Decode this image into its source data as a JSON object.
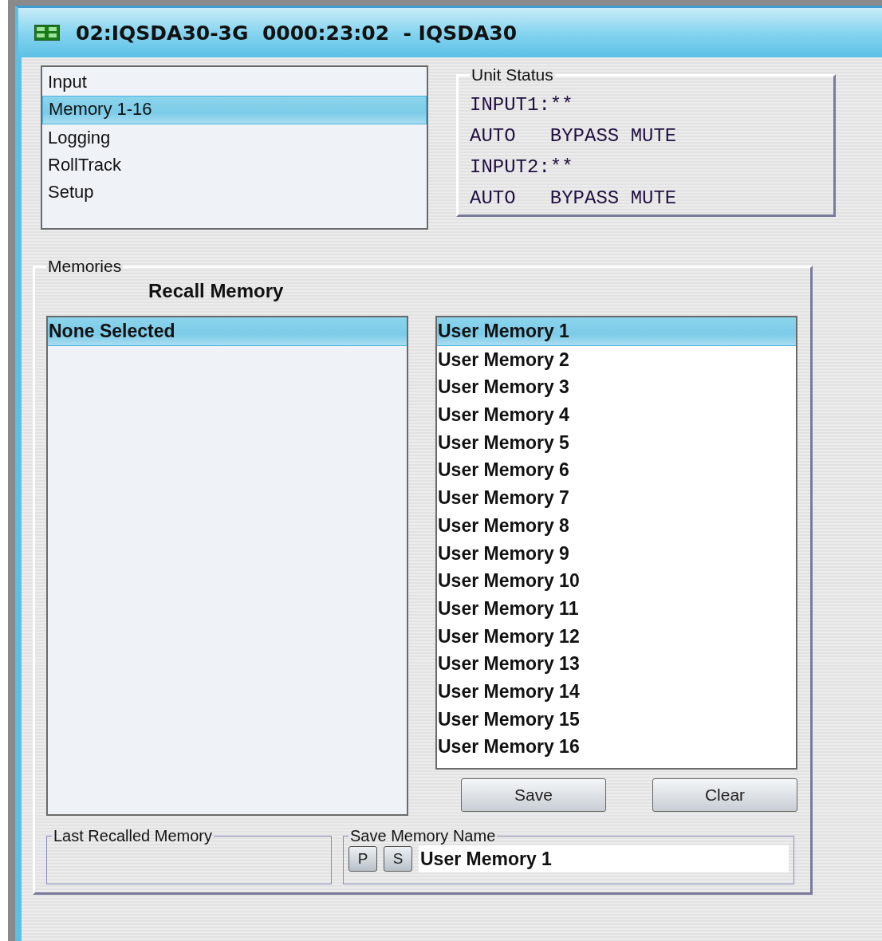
{
  "window": {
    "title": "02:IQSDA30-3G  0000:23:02  - IQSDA30"
  },
  "nav": {
    "items": [
      {
        "label": "Input",
        "selected": false
      },
      {
        "label": "Memory 1-16",
        "selected": true
      },
      {
        "label": "Logging",
        "selected": false
      },
      {
        "label": "RollTrack",
        "selected": false
      },
      {
        "label": "Setup",
        "selected": false
      }
    ]
  },
  "unit_status": {
    "title": "Unit Status",
    "lines": [
      "INPUT1:**",
      "AUTO   BYPASS MUTE",
      "INPUT2:**",
      "AUTO   BYPASS MUTE"
    ]
  },
  "memories": {
    "title": "Memories",
    "recall_label": "Recall Memory",
    "recall_list": [
      {
        "label": "None Selected",
        "selected": true
      }
    ],
    "user_list": [
      {
        "label": "User Memory 1",
        "selected": true
      },
      {
        "label": "User Memory 2",
        "selected": false
      },
      {
        "label": "User Memory 3",
        "selected": false
      },
      {
        "label": "User Memory 4",
        "selected": false
      },
      {
        "label": "User Memory 5",
        "selected": false
      },
      {
        "label": "User Memory 6",
        "selected": false
      },
      {
        "label": "User Memory 7",
        "selected": false
      },
      {
        "label": "User Memory 8",
        "selected": false
      },
      {
        "label": "User Memory 9",
        "selected": false
      },
      {
        "label": "User Memory 10",
        "selected": false
      },
      {
        "label": "User Memory 11",
        "selected": false
      },
      {
        "label": "User Memory 12",
        "selected": false
      },
      {
        "label": "User Memory 13",
        "selected": false
      },
      {
        "label": "User Memory 14",
        "selected": false
      },
      {
        "label": "User Memory 15",
        "selected": false
      },
      {
        "label": "User Memory 16",
        "selected": false
      }
    ],
    "buttons": [
      "Save",
      "Clear"
    ],
    "last_recalled": {
      "title": "Last Recalled Memory"
    },
    "save_name": {
      "title": "Save Memory Name",
      "buttons": [
        "P",
        "S"
      ],
      "value": "User Memory 1"
    }
  }
}
